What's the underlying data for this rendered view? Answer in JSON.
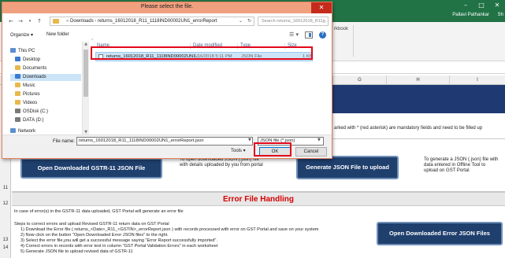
{
  "excel": {
    "app_icon": "X",
    "user_name": "Pallavi Pathankar",
    "share_label": "Sh",
    "ribbon_partial_label": "rkbook",
    "columns": [
      "G",
      "H",
      "I"
    ],
    "row_numbers": [
      "11",
      "12",
      "13",
      "14"
    ],
    "mandatory_note": "arked with * (red asterisk) are mandatory fields and need to be filled up",
    "buttons": {
      "open_gstr11": "Open Downloaded GSTR-11 JSON File",
      "open_gstr11_desc": [
        "To open downloaded JSON (.json) file",
        "with details uploaded by you from portal"
      ],
      "generate_json": "Generate JSON File to upload",
      "generate_json_desc": [
        "To generate a JSON (.json) file with",
        "data entered in Offline Tool to",
        "upload on GST Portal"
      ],
      "open_error_json": "Open Downloaded Error JSON Files"
    },
    "section_title": "Error File Handling",
    "info_line": "In case of error(s) in the GSTR-11 data uploaded, GST Portal will generate an error file",
    "steps": [
      "Steps to correct errors and upload Revised GSTR-11 return data on GST Portal",
      "1) Download the Error file  ( returns_<Date>_R11_<GSTIN>_errorReport.json ) with records processed with error on GST Portal and save on your system",
      "2) Now click on the button \"Open Downloaded Error JSON files\" to the right.",
      "3) Select the error file,you will get a successful message saying \"Error Report successfully imported\".",
      "4) Correct errors in records with error text in column \"GST Portal Validation Errors\" in each worksheet",
      "5) Generate JSON file to upload revised data of GSTR-11"
    ]
  },
  "dialog": {
    "title": "Please select the file.",
    "address": {
      "path": [
        "Downloads",
        "returns_16012018_R11_1118IND00002UN1_errorReport"
      ]
    },
    "search_placeholder": "Search returns_16012018_R11_...",
    "toolbar": {
      "organize": "Organize ▾",
      "new_folder": "New folder"
    },
    "nav_items": [
      {
        "label": "This PC",
        "color": "#5b8fcf"
      },
      {
        "label": "Desktop",
        "color": "#3b7bd4"
      },
      {
        "label": "Documents",
        "color": "#e8b84a"
      },
      {
        "label": "Downloads",
        "color": "#3b7bd4"
      },
      {
        "label": "Music",
        "color": "#e8b84a"
      },
      {
        "label": "Pictures",
        "color": "#e8b84a"
      },
      {
        "label": "Videos",
        "color": "#e8b84a"
      },
      {
        "label": "OSDisk (C:)",
        "color": "#7a7a7a"
      },
      {
        "label": "DATA (D:)",
        "color": "#7a7a7a"
      },
      {
        "label": "Network",
        "color": "#5b8fcf"
      }
    ],
    "selected_nav": "Downloads",
    "file_columns": [
      "Name",
      "Date modified",
      "Type",
      "Size"
    ],
    "files": [
      {
        "name": "returns_16012018_R11_1118IND00002UN1...",
        "date": "1/16/2018 5:11 PM",
        "type": "JSON File",
        "size": "1 KB"
      }
    ],
    "file_name_label": "File name:",
    "file_name_value": "returns_16012018_R11_1118IND00002UN1_errorReport.json",
    "file_type": "JSON file (*.json)",
    "tools_label": "Tools  ▾",
    "ok_label": "OK",
    "cancel_label": "Cancel"
  },
  "colors": {
    "excel_green": "#217346",
    "dialog_title": "#f0a07f",
    "highlight_red": "#e2061b",
    "button_blue": "#1f3f6d",
    "section_red": "#d40000"
  }
}
